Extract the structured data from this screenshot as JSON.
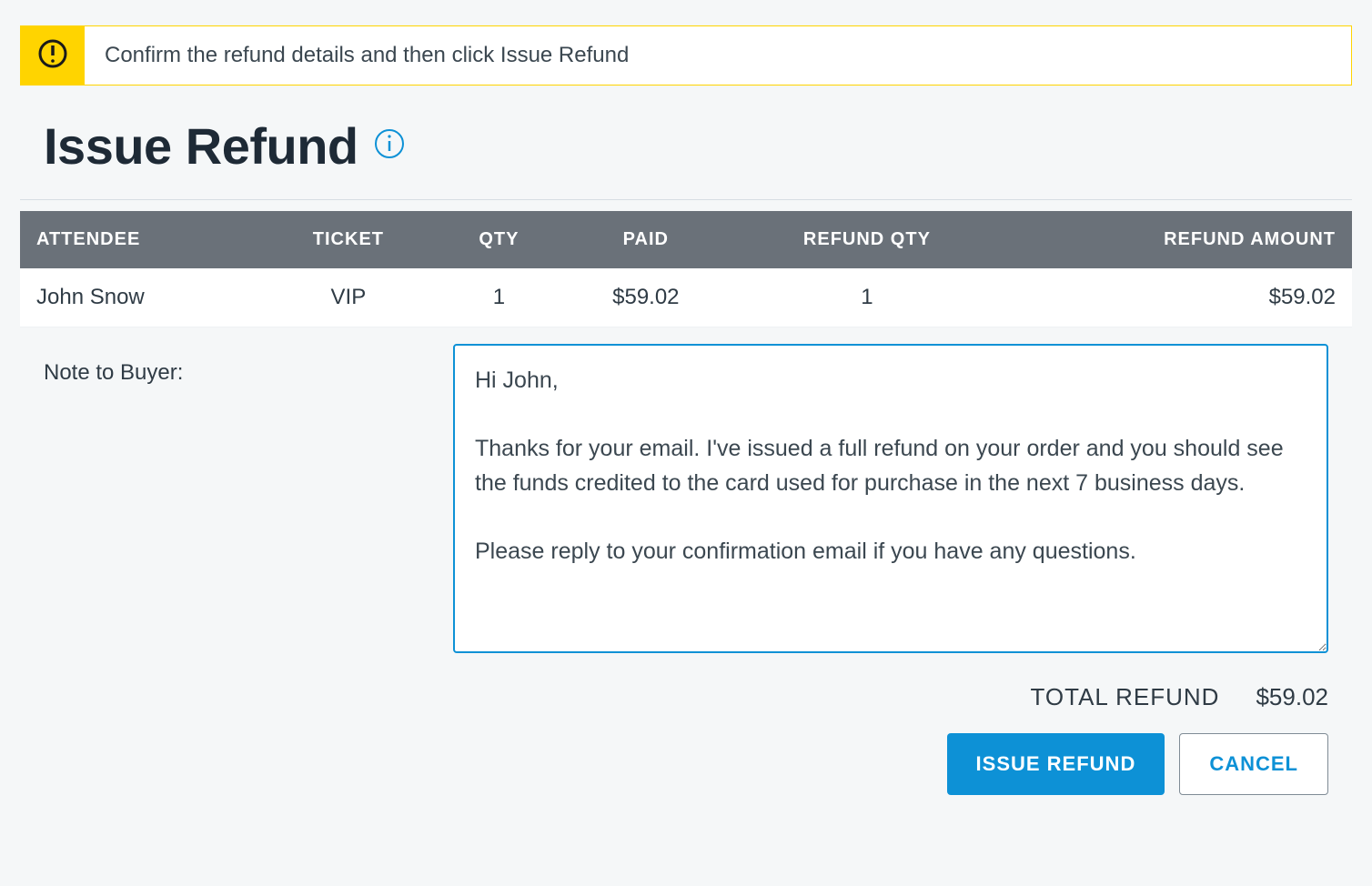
{
  "alert": {
    "text": "Confirm the refund details and then click Issue Refund"
  },
  "page": {
    "title": "Issue Refund"
  },
  "table": {
    "headers": {
      "attendee": "ATTENDEE",
      "ticket": "TICKET",
      "qty": "QTY",
      "paid": "PAID",
      "refund_qty": "REFUND QTY",
      "refund_amount": "REFUND AMOUNT"
    },
    "rows": [
      {
        "attendee": "John Snow",
        "ticket": "VIP",
        "qty": "1",
        "paid": "$59.02",
        "refund_qty": "1",
        "refund_amount": "$59.02"
      }
    ]
  },
  "note": {
    "label": "Note to Buyer:",
    "value": "Hi John,\n\nThanks for your email. I've issued a full refund on your order and you should see the funds credited to the card used for purchase in the next 7 business days.\n\nPlease reply to your confirmation email if you have any questions."
  },
  "total": {
    "label": "TOTAL REFUND",
    "amount": "$59.02"
  },
  "actions": {
    "primary": "ISSUE REFUND",
    "secondary": "CANCEL"
  }
}
